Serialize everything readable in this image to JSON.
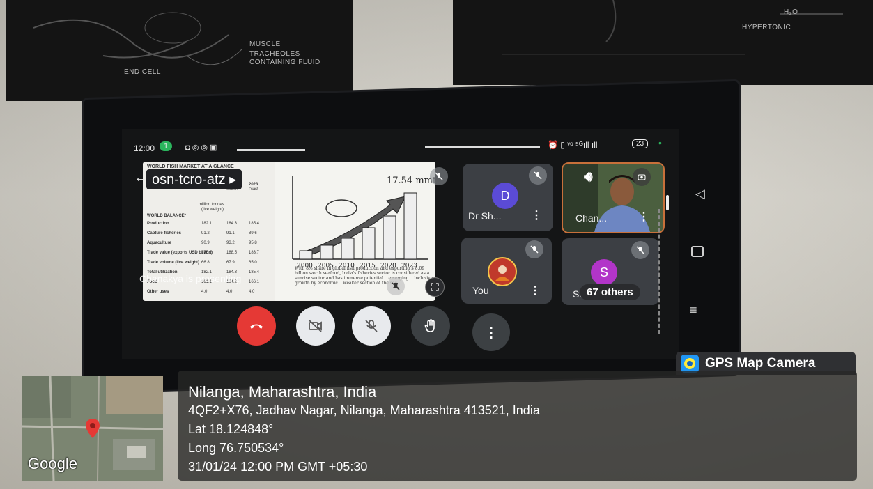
{
  "meet": {
    "code": "osn-tcro-atz",
    "presenting": "Chanakya is presenting",
    "status_time": "12:00",
    "status_call_count": "1",
    "battery": "23",
    "slide": {
      "header": "WORLD FISH MARKET AT A GLANCE",
      "col_2021": "2021",
      "col_2022": "2022",
      "col_2023": "2023",
      "col_2022_sub": "estim.",
      "col_2023_sub": "f'cast",
      "units": "million tonnes",
      "units_sub": "(live weight)",
      "section": "WORLD BALANCE*",
      "rows": [
        {
          "label": "Production",
          "v1": "182.1",
          "v2": "184.3",
          "v3": "185.4"
        },
        {
          "label": "Capture fisheries",
          "v1": "91.2",
          "v2": "91.1",
          "v3": "89.6"
        },
        {
          "label": "Aquaculture",
          "v1": "90.9",
          "v2": "93.2",
          "v3": "95.8"
        },
        {
          "label": "Trade value (exports USD billion)",
          "v1": "175.2",
          "v2": "188.5",
          "v3": "183.7"
        },
        {
          "label": "Trade volume (live weight)",
          "v1": "66.8",
          "v2": "67.9",
          "v3": "65.0"
        },
        {
          "label": "Total utilization",
          "v1": "182.1",
          "v2": "184.3",
          "v3": "185.4"
        },
        {
          "label": "Food",
          "v1": "161.1",
          "v2": "164.2",
          "v3": "166.1"
        },
        {
          "label": "Other uses",
          "v1": "4.0",
          "v2": "4.0",
          "v3": "4.0"
        }
      ],
      "headline": "17.54 mmt",
      "years": [
        "2000",
        "2005",
        "2010",
        "2015",
        "2020",
        "2023"
      ],
      "bar_levels": [
        0.12,
        0.2,
        0.3,
        0.45,
        0.62,
        0.95
      ],
      "body_text": "With 8% share in global fish production and exporting $ 8.09 billion worth seafood, India's fisheries sector is considered as a sunrise sector and has immense potential... emerging ...inclusive growth by economic... weaker section of the soc..."
    },
    "participants": [
      {
        "name": "Dr Sh...",
        "initial": "D",
        "avatar_color": "#5b4bd6",
        "muted": true
      },
      {
        "name": "Chan...",
        "initial": "",
        "muted": false
      },
      {
        "name": "You",
        "initial": "",
        "muted": true
      },
      {
        "name": "Sa...",
        "initial": "S",
        "avatar_color": "#b235c9",
        "muted": true
      }
    ],
    "others_label": "67 others",
    "controls": {
      "end_call": "end-call",
      "camera": "camera-off",
      "mic": "mic-off",
      "raise_hand": "raise-hand",
      "more": "more-options"
    },
    "colors": {
      "end_call": "#e53935",
      "control_grey": "#3c4043",
      "control_light": "#e8eaed"
    }
  },
  "gps": {
    "app_name": "GPS Map Camera",
    "place": "Nilanga, Maharashtra, India",
    "address": "4QF2+X76, Jadhav Nagar, Nilanga, Maharashtra 413521, India",
    "lat": "Lat 18.124848°",
    "long": "Long 76.750534°",
    "timestamp": "31/01/24 12:00 PM GMT +05:30",
    "map_brand": "Google"
  },
  "posters": {
    "left_labels": [
      "MUSCLE",
      "TRACHEOLES",
      "CONTAINING FLUID",
      "END CELL"
    ],
    "right_labels": [
      "H₂O",
      "HYPERTONIC"
    ]
  }
}
